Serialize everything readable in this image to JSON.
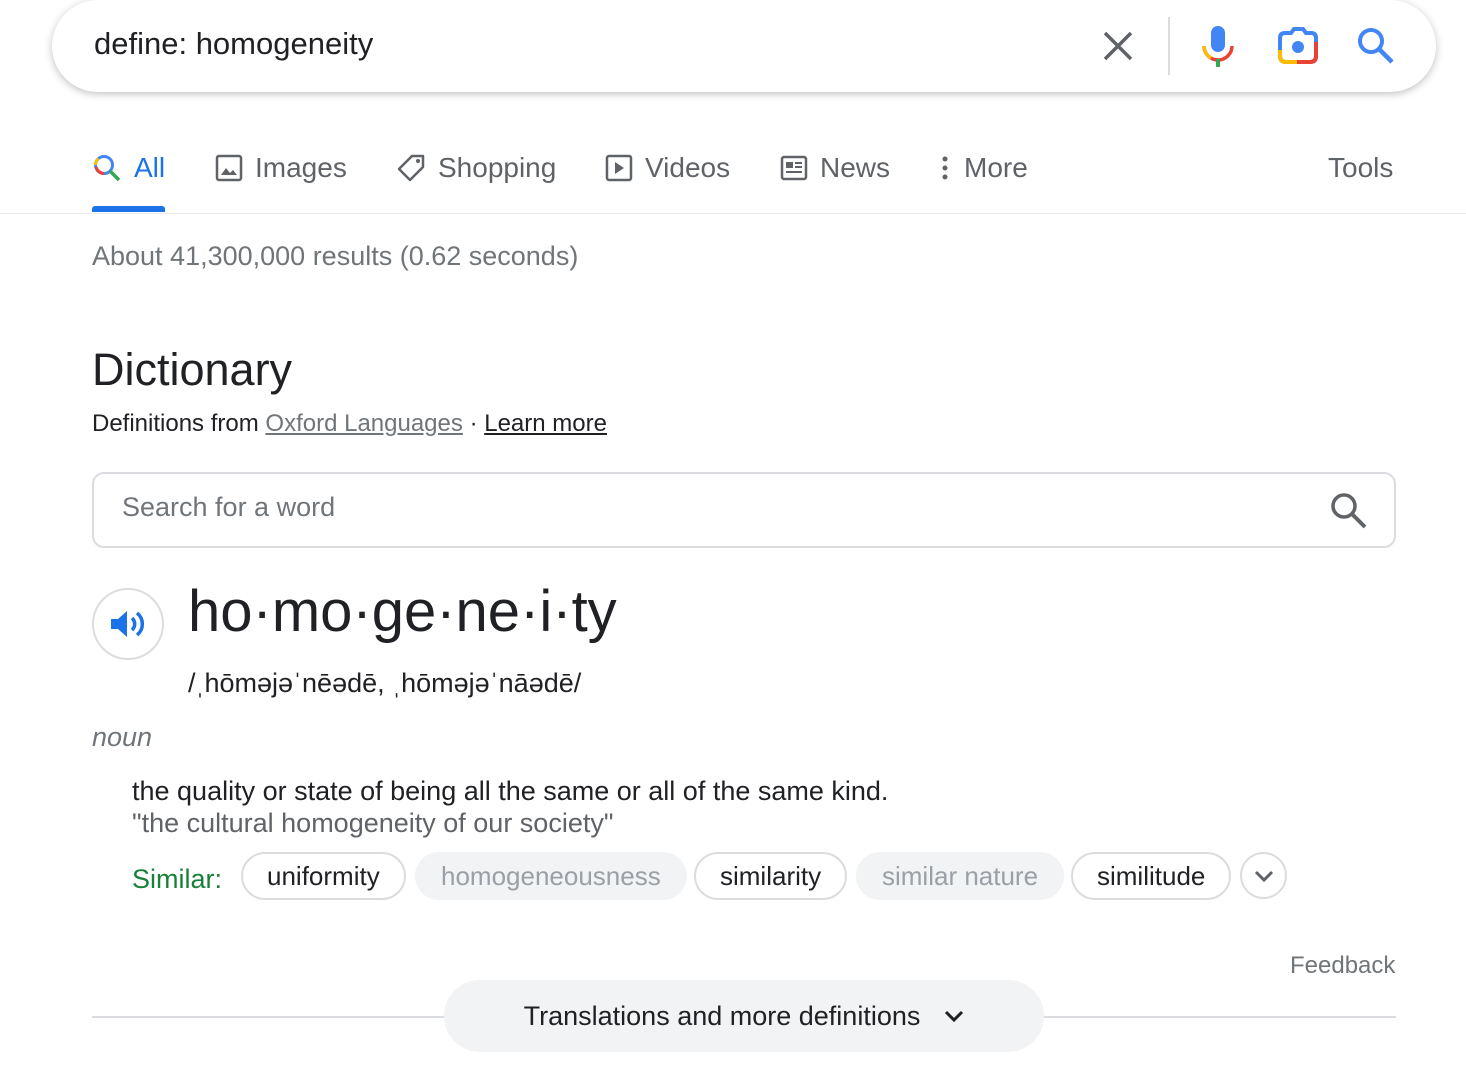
{
  "search": {
    "query": "define: homogeneity",
    "icons": [
      "close-icon",
      "microphone-icon",
      "camera-lens-icon",
      "search-icon"
    ]
  },
  "tabs": [
    {
      "label": "All",
      "icon": "search-icon"
    },
    {
      "label": "Images",
      "icon": "image-icon"
    },
    {
      "label": "Shopping",
      "icon": "tag-icon"
    },
    {
      "label": "Videos",
      "icon": "play-icon"
    },
    {
      "label": "News",
      "icon": "newspaper-icon"
    },
    {
      "label": "More",
      "icon": "more-vert-icon"
    }
  ],
  "tools_label": "Tools",
  "stats": "About 41,300,000 results (0.62 seconds)",
  "dictionary": {
    "heading": "Dictionary",
    "source_prefix": "Definitions from",
    "source_link": "Oxford Languages",
    "separator": "·",
    "learn_more": "Learn more",
    "search_placeholder": "Search for a word",
    "word": "ho·mo·ge·ne·i·ty",
    "phonetic": "/ˌhōməjəˈnēədē, ˌhōməjəˈnāədē/",
    "part_of_speech": "noun",
    "definition": "the quality or state of being all the same or all of the same kind.",
    "example": "\"the cultural homogeneity of our society\"",
    "similar_label": "Similar:",
    "similar": [
      {
        "label": "uniformity",
        "enabled": true
      },
      {
        "label": "homogeneousness",
        "enabled": false
      },
      {
        "label": "similarity",
        "enabled": true
      },
      {
        "label": "similar nature",
        "enabled": false
      },
      {
        "label": "similitude",
        "enabled": true
      }
    ],
    "feedback": "Feedback",
    "more_definitions": "Translations and more definitions"
  },
  "colors": {
    "accent": "#1a73e8",
    "similar": "#188038"
  }
}
